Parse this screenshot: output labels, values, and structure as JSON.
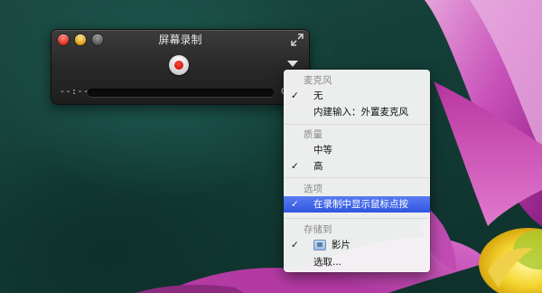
{
  "window": {
    "title": "屏幕录制",
    "time": "--:--",
    "size_text": "0"
  },
  "icons": {
    "close": "close-button",
    "minimize": "minimize-button",
    "zoom": "zoom-button",
    "fullscreen": "fullscreen-icon",
    "record": "record-icon",
    "options": "triangle-down-icon",
    "folder": "folder-icon",
    "check": "checkmark-icon"
  },
  "menu": {
    "microphone_header": "麦克风",
    "mic_none": "无",
    "mic_internal": "内建输入：外置麦克风",
    "quality_header": "质量",
    "quality_medium": "中等",
    "quality_high": "高",
    "options_header": "选项",
    "show_clicks": "在录制中显示鼠标点按",
    "save_header": "存储到",
    "save_movies": "影片",
    "save_other": "选取...",
    "check": "✓"
  },
  "colors": {
    "selection": "#3a5fe6",
    "record_red": "#e01a10"
  }
}
